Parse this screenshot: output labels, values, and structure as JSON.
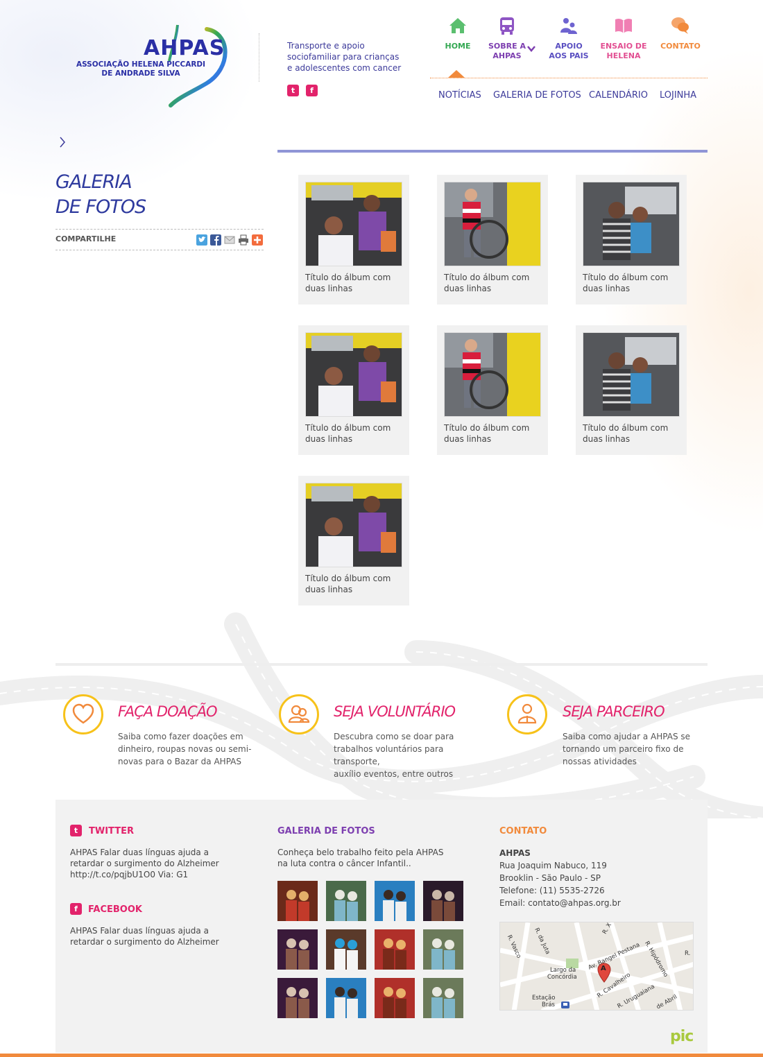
{
  "brand": {
    "logo_word": "AHPAS",
    "logo_subtitle_line1": "ASSOCIAÇÃO HELENA PICCARDI",
    "logo_subtitle_line2": "DE ANDRADE SILVA",
    "tagline_line1": "Transporte e apoio",
    "tagline_line2": "sociofamiliar para crianças",
    "tagline_line3": "e adolescentes com cancer",
    "social_twitter": "t",
    "social_facebook": "f"
  },
  "nav": {
    "items": [
      {
        "label1": "HOME",
        "label2": "",
        "icon": "home-icon",
        "color": "#34a853"
      },
      {
        "label1": "SOBRE A",
        "label2": "AHPAS",
        "icon": "bus-icon",
        "color": "#7d3fb0"
      },
      {
        "label1": "APOIO",
        "label2": "AOS PAIS",
        "icon": "people-icon",
        "color": "#5a4fc1"
      },
      {
        "label1": "ENSAIO DE",
        "label2": "HELENA",
        "icon": "book-icon",
        "color": "#e24f92"
      },
      {
        "label1": "CONTATO",
        "label2": "",
        "icon": "chat-icon",
        "color": "#f18a3c"
      }
    ],
    "sub": [
      "NOTÍCIAS",
      "GALERIA DE FOTOS",
      "CALENDÁRIO",
      "LOJINHA"
    ]
  },
  "page": {
    "breadcrumb_icon": "chevron-right-icon",
    "title_line1": "GALERIA",
    "title_line2": "DE FOTOS",
    "share_label": "COMPARTILHE"
  },
  "gallery": [
    {
      "line1": "Título do álbum com",
      "line2": "duas linhas",
      "photo": "girl-and-woman-in-car"
    },
    {
      "line1": "Título do álbum com",
      "line2": "duas linhas",
      "photo": "young-man-wheelchair"
    },
    {
      "line1": "Título do álbum com",
      "line2": "duas linhas",
      "photo": "woman-and-boy-in-van"
    },
    {
      "line1": "Título do álbum com",
      "line2": "duas linhas",
      "photo": "girl-and-woman-in-car"
    },
    {
      "line1": "Título do álbum com",
      "line2": "duas linhas",
      "photo": "young-man-wheelchair"
    },
    {
      "line1": "Título do álbum com",
      "line2": "duas linhas",
      "photo": "woman-and-boy-in-van"
    },
    {
      "line1": "Título do álbum com",
      "line2": "duas linhas",
      "photo": "girl-and-woman-in-car"
    }
  ],
  "cta": [
    {
      "title": "FAÇA DOAÇÃO",
      "icon": "heart-icon",
      "l1": "Saiba como fazer doações em",
      "l2": "dinheiro, roupas novas ou semi-",
      "l3": "novas para o Bazar da AHPAS"
    },
    {
      "title": "SEJA VOLUNTÁRIO",
      "icon": "volunteers-icon",
      "l1": "Descubra como se doar para",
      "l2": "trabalhos voluntários para transporte,",
      "l3": "auxílio eventos, entre outros"
    },
    {
      "title": "SEJA PARCEIRO",
      "icon": "partner-icon",
      "l1": "Saiba como ajudar a AHPAS se",
      "l2": "tornando um parceiro fixo de",
      "l3": "nossas atividades"
    }
  ],
  "footer": {
    "twitter_title": "TWITTER",
    "twitter_l1": "AHPAS Falar duas línguas ajuda a",
    "twitter_l2": "retardar o surgimento do Alzheimer",
    "twitter_l3": "http://t.co/pqjbU1O0 Via: G1",
    "facebook_title": "FACEBOOK",
    "facebook_l1": "AHPAS Falar duas línguas ajuda a",
    "facebook_l2": "retardar o surgimento do Alzheimer",
    "gallery_title": "GALERIA DE FOTOS",
    "gallery_l1": "Conheça belo trabalho feito pela AHPAS",
    "gallery_l2": "na luta contra o câncer Infantil..",
    "contact_title": "CONTATO",
    "contact_name": "AHPAS",
    "contact_l1": "Rua Joaquim Nabuco, 119",
    "contact_l2": "Brooklin - São Paulo - SP",
    "contact_l3": "Telefone: (11) 5535-2726",
    "contact_l4": "Email: contato@ahpas.org.br",
    "map_labels": [
      "Largo da",
      "Concórdia",
      "Estação",
      "Brás",
      "R. Vasco",
      "R. da Juta",
      "Av. Rangel Pestana",
      "R. Hipódromo",
      "R. Cavalheiro",
      "R. Uruguaiana",
      "de Abril",
      "R. X",
      "R."
    ],
    "map_marker": "A",
    "credit": "pic"
  },
  "colors": {
    "primary": "#2e3a9e",
    "accent_pink": "#e2236b",
    "accent_orange": "#f18a3c",
    "accent_yellow": "#f7c21a",
    "home_green": "#34a853"
  }
}
